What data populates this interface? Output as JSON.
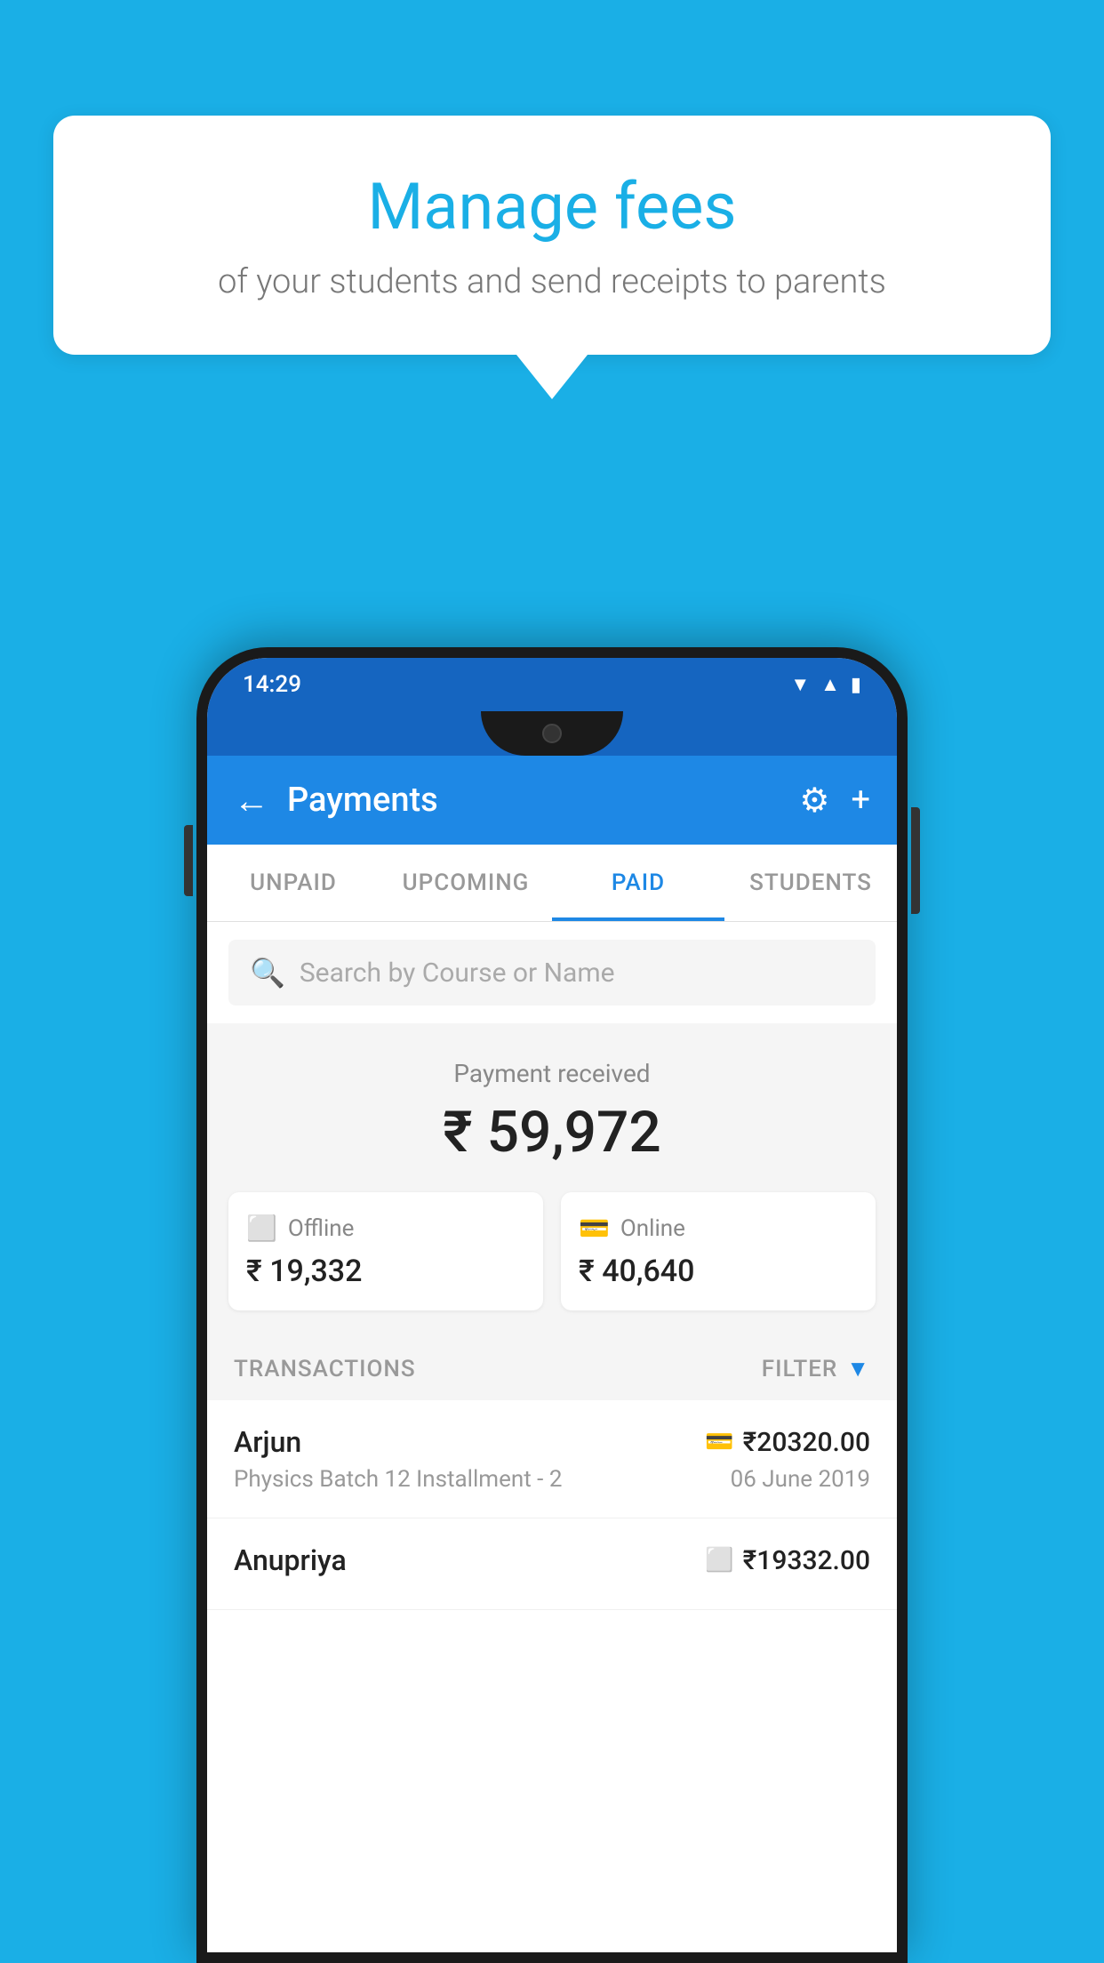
{
  "background": {
    "color": "#1AAFE6"
  },
  "speech_bubble": {
    "title": "Manage fees",
    "subtitle": "of your students and send receipts to parents"
  },
  "status_bar": {
    "time": "14:29",
    "icons": [
      "wifi",
      "signal",
      "battery"
    ]
  },
  "app_header": {
    "title": "Payments",
    "back_label": "←",
    "gear_label": "⚙",
    "plus_label": "+"
  },
  "tabs": [
    {
      "label": "UNPAID",
      "active": false
    },
    {
      "label": "UPCOMING",
      "active": false
    },
    {
      "label": "PAID",
      "active": true
    },
    {
      "label": "STUDENTS",
      "active": false
    }
  ],
  "search": {
    "placeholder": "Search by Course or Name"
  },
  "payment_summary": {
    "label": "Payment received",
    "total": "₹ 59,972",
    "offline_label": "Offline",
    "offline_amount": "₹ 19,332",
    "online_label": "Online",
    "online_amount": "₹ 40,640"
  },
  "transactions_section": {
    "label": "TRANSACTIONS",
    "filter_label": "FILTER"
  },
  "transactions": [
    {
      "name": "Arjun",
      "detail": "Physics Batch 12 Installment - 2",
      "amount": "₹20320.00",
      "date": "06 June 2019",
      "payment_type": "online"
    },
    {
      "name": "Anupriya",
      "detail": "",
      "amount": "₹19332.00",
      "date": "",
      "payment_type": "offline"
    }
  ]
}
